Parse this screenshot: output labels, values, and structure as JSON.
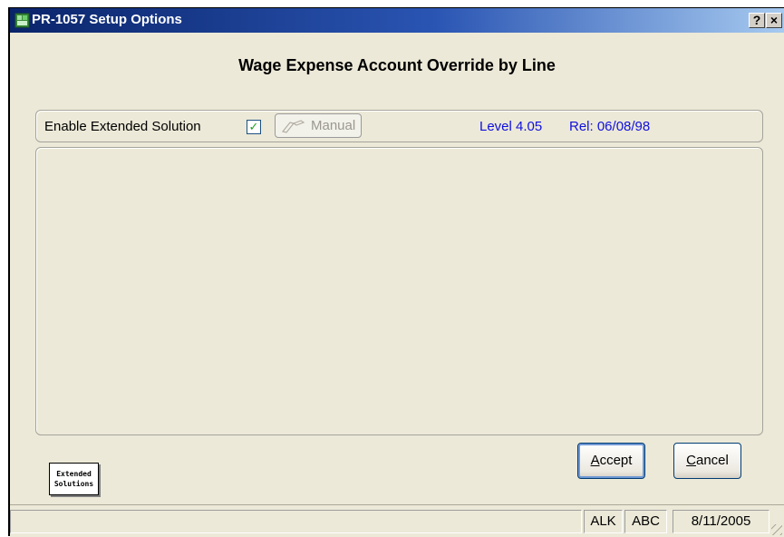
{
  "window": {
    "title": "PR-1057 Setup Options",
    "help_label": "?",
    "close_label": "×"
  },
  "heading": "Wage Expense Account Override by Line",
  "options": {
    "enable_label": "Enable Extended Solution",
    "enable_checked": true,
    "checkbox_mark": "✓",
    "manual_label": "Manual",
    "level": "Level 4.05",
    "release": "Rel: 06/08/98"
  },
  "logo": {
    "line1": "Extended",
    "line2": "Solutions"
  },
  "buttons": {
    "accept": {
      "mnemonic": "A",
      "rest": "ccept"
    },
    "cancel": {
      "mnemonic": "C",
      "rest": "ancel"
    }
  },
  "status": {
    "main": "",
    "user": "ALK",
    "company": "ABC",
    "date": "8/11/2005"
  },
  "colors": {
    "titlebar_start": "#0a246a",
    "titlebar_end": "#a6caf0",
    "version_text": "#1010dd",
    "face": "#ece9d8"
  },
  "icons": {
    "app": "app-icon",
    "manual": "manual-book-icon",
    "help": "help-icon",
    "close": "close-icon"
  }
}
